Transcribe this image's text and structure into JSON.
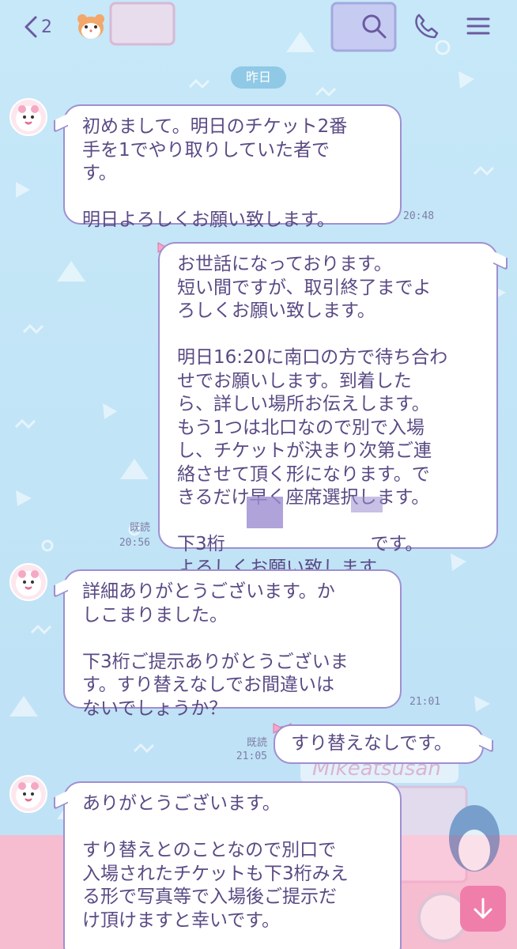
{
  "header": {
    "unread_count": "2",
    "icons": [
      "back-chevron-icon",
      "hamster-icon",
      "search-icon",
      "phone-icon",
      "menu-icon"
    ]
  },
  "date_separator": "昨日",
  "messages": [
    {
      "side": "in",
      "text": "初めまして。明日のチケット2番\n手を1でやり取りしていた者で\nす。\n\n明日よろしくお願い致します。",
      "time": "20:48"
    },
    {
      "side": "out",
      "text": "お世話になっております。\n短い間ですが、取引終了までよ\nろしくお願い致します。\n\n明日16:20に南口の方で待ち合わ\nせでお願いします。到着した\nら、詳しい場所お伝えします。\nもう1つは北口なので別で入場\nし、チケットが決まり次第ご連\n絡させて頂く形になります。で\nきるだけ早く座席選択します。\n\n下3桁　　　　　　　　です。\nよろしくお願い致します。",
      "read": "既読",
      "time": "20:56"
    },
    {
      "side": "in",
      "text": "詳細ありがとうございます。か\nしこまりました。\n\n下3桁ご提示ありがとうございま\nす。すり替えなしでお間違いは\nないでしょうか？",
      "time": "21:01"
    },
    {
      "side": "out",
      "text": "すり替えなしです。",
      "read": "既読",
      "time": "21:05"
    },
    {
      "side": "in",
      "text": "ありがとうございます。\n\nすり替えとのことなので別口で\n入場されたチケットも下3桁みえ\nる形で写真等で入場後ご提示だ\nけ頂けますと幸いです。",
      "time": ""
    }
  ],
  "background_sign": "Mikeatsusan",
  "colors": {
    "bubble_border": "#9f8fd0",
    "text": "#5a4a84",
    "background": "#c6e8f8",
    "floor": "#f6bcd0",
    "fab": "#f07eaa"
  }
}
